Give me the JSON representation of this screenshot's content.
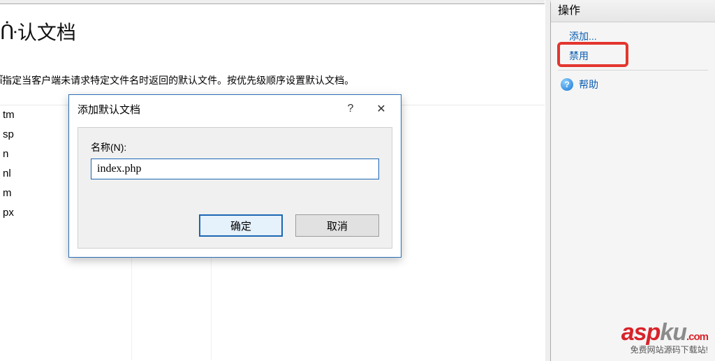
{
  "page": {
    "title": "ᑜ认文档",
    "description": "ἶ指定当客户端未请求特定文件名时返回的默认文件。按优先级顺序设置默认文档。"
  },
  "grid": {
    "rows": [
      "tm",
      "sp",
      "n",
      "nl",
      "m",
      "px"
    ]
  },
  "actions": {
    "panel_title": "操作",
    "add_label": "添加...",
    "disable_label": "禁用",
    "help_label": "帮助"
  },
  "dialog": {
    "title": "添加默认文档",
    "help_symbol": "?",
    "close_symbol": "✕",
    "name_label": "名称(N):",
    "name_value": "index.php",
    "ok_label": "确定",
    "cancel_label": "取消"
  },
  "watermark": {
    "brand_prefix": "asp",
    "brand_mid": "ku",
    "brand_suffix": ".com",
    "tagline": "免费网站源码下载站!"
  }
}
